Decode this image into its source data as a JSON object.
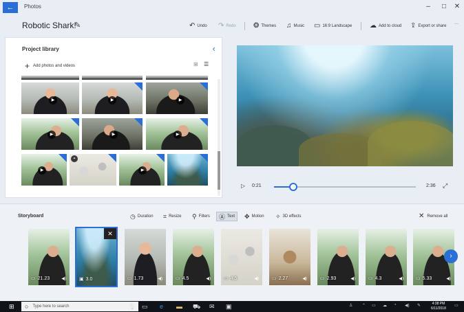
{
  "window": {
    "app_name": "Photos",
    "back_icon": "back-arrow-icon",
    "controls": {
      "minimize": "–",
      "maximize": "□",
      "close": "✕"
    }
  },
  "toolbar": {
    "project_title": "Robotic Shark!",
    "undo": "Undo",
    "redo": "Redo",
    "themes": "Themes",
    "music": "Music",
    "aspect": "16:9 Landscape",
    "add_to_cloud": "Add to cloud",
    "export": "Export or share",
    "more": "···"
  },
  "library": {
    "title": "Project library",
    "add_label": "Add photos and videos"
  },
  "player": {
    "current_time": "0:21",
    "total_time": "2:36",
    "progress": 0.135
  },
  "storyboard": {
    "title": "Storyboard",
    "tools": {
      "duration": "Duration",
      "resize": "Resize",
      "filters": "Filters",
      "text": "Text",
      "motion": "Motion",
      "effects": "3D effects"
    },
    "remove_all": "Remove all",
    "cards": [
      {
        "duration": "21.23",
        "type": "video"
      },
      {
        "duration": "3.0",
        "type": "photo"
      },
      {
        "duration": "1.73",
        "type": "video"
      },
      {
        "duration": "4.5",
        "type": "video"
      },
      {
        "duration": "4.5",
        "type": "video"
      },
      {
        "duration": "2.27",
        "type": "video"
      },
      {
        "duration": "2.93",
        "type": "video"
      },
      {
        "duration": "4.3",
        "type": "video"
      },
      {
        "duration": "5.33",
        "type": "video"
      }
    ]
  },
  "taskbar": {
    "search_placeholder": "Type here to search",
    "time": "4:38 PM",
    "date": "6/11/2018"
  },
  "colors": {
    "accent": "#2b6fd6",
    "background": "#e9eef5",
    "taskbar": "#101418"
  }
}
